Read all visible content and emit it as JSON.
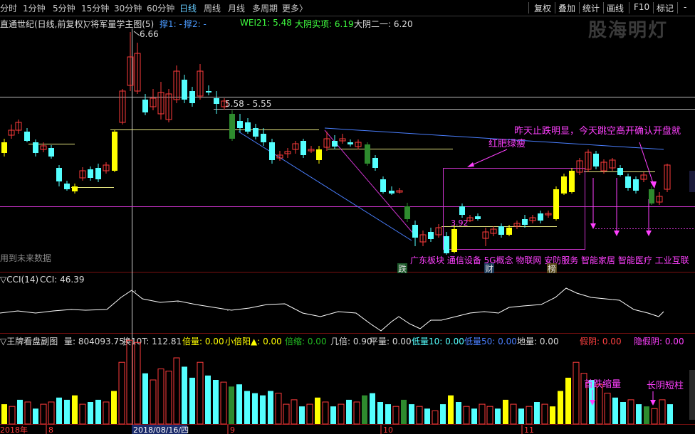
{
  "toolbar": {
    "left": [
      "分时",
      "1分钟",
      "5分钟",
      "15分钟",
      "30分钟",
      "60分钟",
      "日线",
      "周线",
      "月线",
      "多周期",
      "更多〉"
    ],
    "right": [
      "复权",
      "叠加",
      "统计",
      "画线",
      "F10",
      "标记",
      "-"
    ]
  },
  "watermark": "股海明灯",
  "main_header": {
    "title": "直通世纪(日线,前复权)",
    "formula": "▽将军量学主图(5)",
    "s1": "撑1: -",
    "s2": "撑2: -",
    "wei": "WEI21: 5.48",
    "dyshi": "大阴实项: 6.19",
    "dyer": "大阴二一: 6.20"
  },
  "labels": {
    "high": "6.66",
    "range": "5.58 - 5.55",
    "low": "3.92",
    "future": "用到未来数据",
    "annot1": "昨天止跌明显，今天跳空高开确认开盘就",
    "annot2": "红肥绿瘦",
    "sectors": "广东板块 通信设备 5G概念 物联网 安防服务 智能家居 智能医疗 工业互联",
    "tag_die": "跌",
    "tag_cai": "财",
    "tag_bang": "榜"
  },
  "cci_header": {
    "name": "▽CCI(14)",
    "value": "CCI: 46.39"
  },
  "vol_header": {
    "name": "▽王牌看盘副图",
    "vol": "量: 804093.75",
    "hsl": "换10T: 112.81",
    "bl": "倍量: 0.00",
    "xbl": "小倍阳▲: 0.00",
    "bs": "倍缩: 0.00",
    "jb": "几倍: 0.90",
    "pl": "平量: 0.00",
    "dl10": "低量10: 0.00",
    "dl50": "低量50: 0.00",
    "dil": "地量: 0.00",
    "jy": "假阴: 0.00",
    "yjy": "隐假阴: 0.00"
  },
  "vol_annots": {
    "a1": "首跌缩量",
    "a2": "长阴短柱"
  },
  "date_axis": [
    "2018年",
    "8",
    "2018/08/16/四",
    "9",
    "10",
    "11"
  ],
  "colors": {
    "up": "#ff3c3c",
    "down": "#54ffff",
    "yellow": "#ffff00",
    "green": "#2e8b2e",
    "magenta": "#ff40ff",
    "blue": "#4a7fff"
  }
}
